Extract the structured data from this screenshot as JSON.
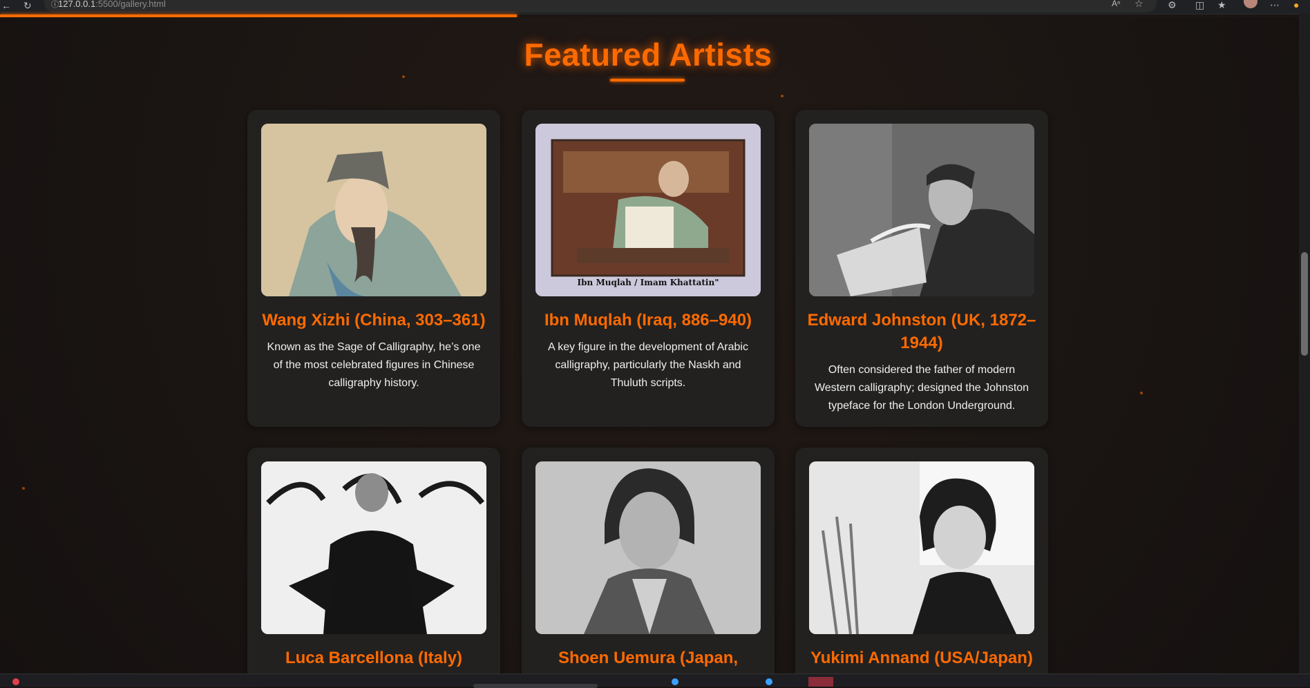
{
  "browser": {
    "url_host": "127.0.0.1",
    "url_path": ":5500/gallery.html",
    "icons": [
      "back-arrow-icon",
      "refresh-icon",
      "info-icon",
      "read-aloud-icon",
      "favorite-star-icon",
      "extensions-icon",
      "split-screen-icon",
      "favorites-icon",
      "profile-avatar",
      "more-menu-icon",
      "copilot-icon"
    ]
  },
  "section": {
    "title": "Featured Artists"
  },
  "artists": [
    {
      "name": "Wang Xizhi (China, 303–361)",
      "description": "Known as the Sage of Calligraphy, he’s one of the most celebrated figures in Chinese calligraphy history.",
      "image": "wang-xizhi-portrait"
    },
    {
      "name": "Ibn Muqlah (Iraq, 886–940)",
      "description": "A key figure in the development of Arabic calligraphy, particularly the Naskh and Thuluth scripts.",
      "image": "ibn-muqlah-painting",
      "image_caption": "Ibn Muqlah / Imam Khattatin\""
    },
    {
      "name": "Edward Johnston (UK, 1872–1944)",
      "description": "Often considered the father of modern Western calligraphy; designed the Johnston typeface for the London Underground.",
      "image": "edward-johnston-photo"
    },
    {
      "name": "Luca Barcellona (Italy)",
      "description": "",
      "image": "luca-barcellona-photo"
    },
    {
      "name": "Shoen Uemura (Japan,",
      "description": "",
      "image": "shoen-uemura-photo"
    },
    {
      "name": "Yukimi Annand (USA/Japan)",
      "description": "",
      "image": "yukimi-annand-photo"
    }
  ],
  "colors": {
    "accent": "#ff6a00",
    "background": "#1b1614",
    "card": "#222120",
    "text": "#efefef"
  }
}
